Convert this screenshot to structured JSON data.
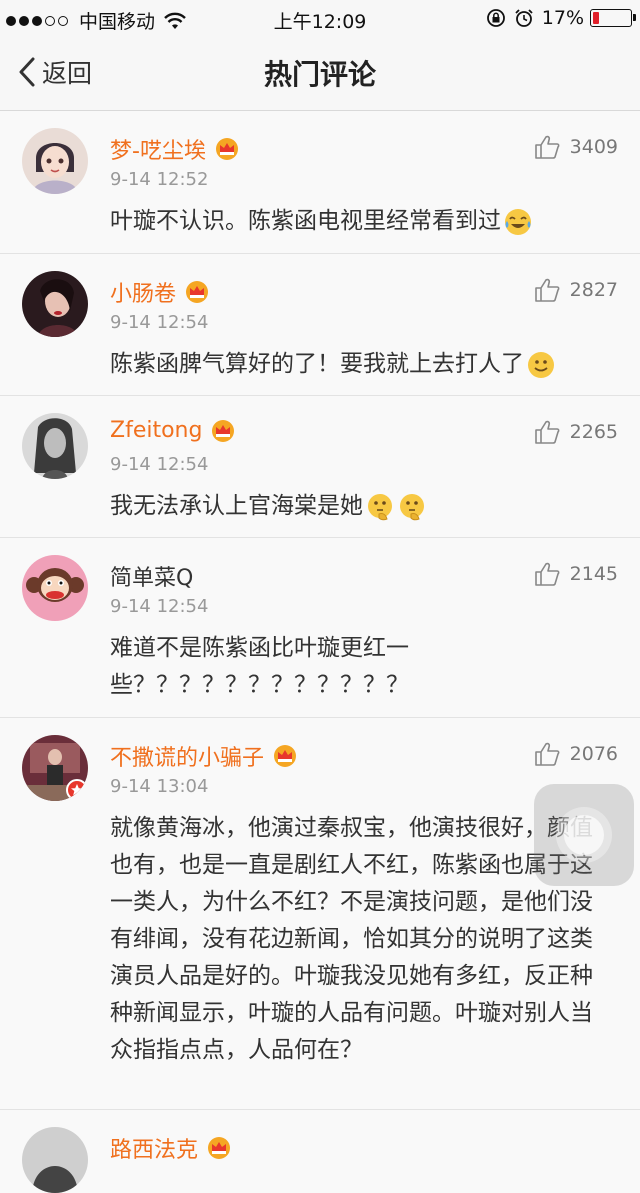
{
  "status_bar": {
    "carrier": "中国移动",
    "time": "上午12:09",
    "battery": "17%",
    "battery_level": 0.17
  },
  "nav": {
    "back_label": "返回",
    "title": "热门评论"
  },
  "comments": [
    {
      "name": "梦-呓尘埃",
      "time": "9-14 12:52",
      "likes": "3409",
      "text": "叶璇不认识。陈紫函电视里经常看到过"
    },
    {
      "name": "小肠卷",
      "time": "9-14 12:54",
      "likes": "2827",
      "text": "陈紫函脾气算好的了！要我就上去打人了"
    },
    {
      "name": "Zfeitong",
      "time": "9-14 12:54",
      "likes": "2265",
      "text": "我无法承认上官海棠是她"
    },
    {
      "name": "简单菜Q",
      "time": "9-14 12:54",
      "likes": "2145",
      "text": "难道不是陈紫函比叶璇更红一些？？？？？？？？？？？？"
    },
    {
      "name": "不撒谎的小骗子",
      "time": "9-14 13:04",
      "likes": "2076",
      "text": "就像黄海冰，他演过秦叔宝，他演技很好，颜值也有，也是一直是剧红人不红，陈紫函也属于这一类人，为什么不红？不是演技问题，是他们没有绯闻，没有花边新闻，恰如其分的说明了这类演员人品是好的。叶璇我没见她有多红，反正种种新闻显示，叶璇的人品有问题。叶璇对别人当众指指点点，人品何在？"
    },
    {
      "name": "路西法克"
    }
  ],
  "colors": {
    "vip_name": "#f0701e",
    "meta": "#999999",
    "background": "#f9f9f9"
  }
}
